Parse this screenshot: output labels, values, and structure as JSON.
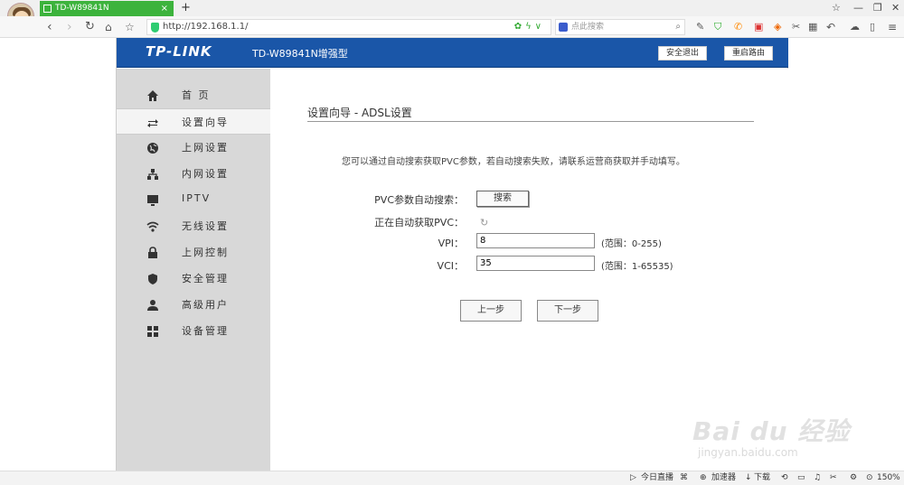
{
  "browser": {
    "tab_title": "TD-W89841N",
    "new_tab": "+",
    "tab_close": "×",
    "url": "http://192.168.1.1/",
    "search_placeholder": "点此搜索",
    "zoom": "150%"
  },
  "router": {
    "logo": "TP-LINK",
    "model": "TD-W89841N增强型",
    "logout_label": "安全退出",
    "reboot_label": "重启路由"
  },
  "sidebar": {
    "items": [
      {
        "label": "首 页",
        "icon": "home-icon"
      },
      {
        "label": "设置向导",
        "icon": "arrows-icon"
      },
      {
        "label": "上网设置",
        "icon": "globe-icon"
      },
      {
        "label": "内网设置",
        "icon": "network-icon"
      },
      {
        "label": "IPTV",
        "icon": "monitor-icon"
      },
      {
        "label": "无线设置",
        "icon": "wifi-icon"
      },
      {
        "label": "上网控制",
        "icon": "lock-icon"
      },
      {
        "label": "安全管理",
        "icon": "shield-icon"
      },
      {
        "label": "高级用户",
        "icon": "user-icon"
      },
      {
        "label": "设备管理",
        "icon": "grid-icon"
      }
    ],
    "active_index": 1
  },
  "wizard": {
    "title": "设置向导 - ADSL设置",
    "intro": "您可以通过自动搜索获取PVC参数，若自动搜索失败，请联系运营商获取并手动填写。",
    "auto_search_label": "PVC参数自动搜索：",
    "search_button": "搜索",
    "status_label": "正在自动获取PVC：",
    "vpi_label": "VPI：",
    "vpi_value": "8",
    "vpi_range": "(范围：0-255)",
    "vci_label": "VCI：",
    "vci_value": "35",
    "vci_range": "(范围：1-65535)",
    "prev_button": "上一步",
    "next_button": "下一步"
  },
  "statusbar": {
    "live": "今日直播",
    "accelerator": "加速器",
    "download": "下载"
  },
  "watermark": {
    "brand": "Bai du 经验",
    "url": "jingyan.baidu.com"
  }
}
